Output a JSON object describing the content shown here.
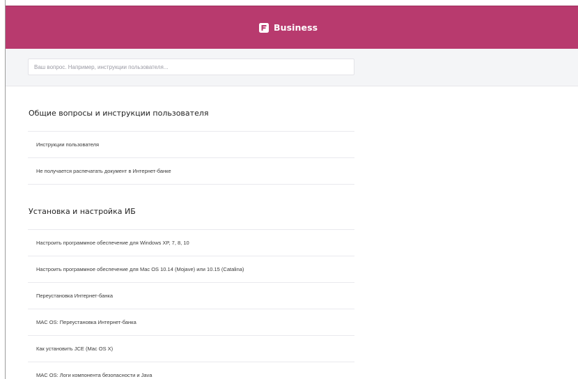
{
  "header": {
    "brand_name": "Business",
    "logo_icon": "bank-logo-icon",
    "background_color": "#b83a6e"
  },
  "search": {
    "placeholder": "Ваш вопрос. Например, инструкции пользователя...",
    "value": ""
  },
  "sections": [
    {
      "title": "Общие вопросы и инструкции пользователя",
      "items": [
        "Инструкции пользователя",
        "Не получается распечатать документ в Интернет-банке"
      ]
    },
    {
      "title": "Установка и настройка ИБ",
      "items": [
        "Настроить программное обеспечение для Windows XP, 7, 8, 10",
        "Настроить программное обеспечение для Mac OS 10.14 (Mojave) или 10.15 (Catalina)",
        "Переустановка Интернет-банка",
        "MAC OS: Переустановка Интернет-банка",
        "Как установить JCE (Mac OS X)",
        "MAC OS: Логи компонента безопасности и Java"
      ]
    }
  ]
}
